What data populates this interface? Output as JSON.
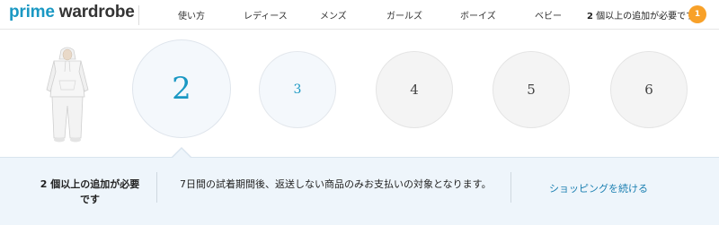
{
  "header": {
    "logo_part1": "prime",
    "logo_part2": "wardrobe",
    "nav": [
      "使い方",
      "レディース",
      "メンズ",
      "ガールズ",
      "ボーイズ",
      "ベビー"
    ],
    "requirement_count": "2",
    "requirement_suffix": " 個以上の追加が必要です",
    "cart_count": "1"
  },
  "slots": [
    "2",
    "3",
    "4",
    "5",
    "6"
  ],
  "panel": {
    "left_count": "2",
    "left_text": " 個以上の追加が必要です",
    "message": "7日間の試着期間後、返送しない商品のみお支払いの対象となります。",
    "continue_link": "ショッピングを続ける"
  },
  "colors": {
    "brand": "#1a98c3",
    "badge": "#f8a129",
    "panel_bg": "#eef5fb"
  }
}
